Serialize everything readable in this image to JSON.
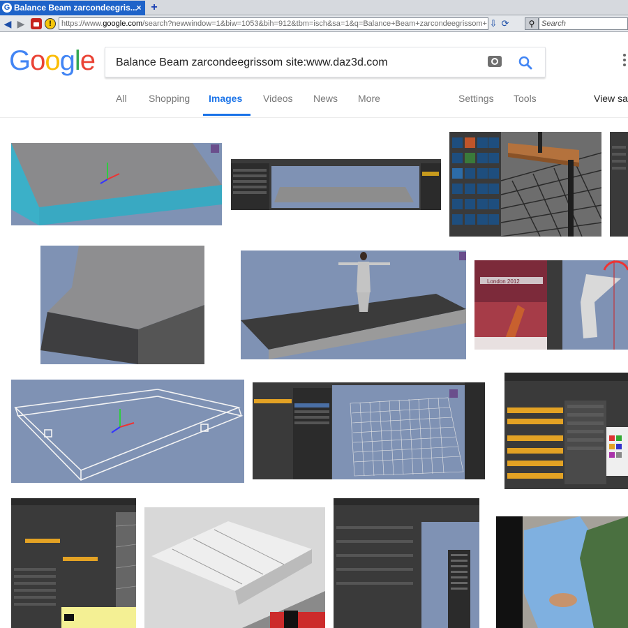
{
  "browser": {
    "tab_title": "Balance Beam zarcondeegris...",
    "tab_close": "×",
    "new_tab": "+",
    "url_prefix": "https://www.",
    "url_domain": "google.com",
    "url_rest": "/search?newwindow=1&biw=1053&bih=912&tbm=isch&sa=1&q=Balance+Beam+zarcondeegrissom+",
    "search_placeholder": "Search"
  },
  "google": {
    "logo_letters": [
      "G",
      "o",
      "o",
      "g",
      "l",
      "e"
    ],
    "logo_colors": [
      "#4285F4",
      "#EA4335",
      "#FBBC05",
      "#4285F4",
      "#34A853",
      "#EA4335"
    ],
    "query": "Balance Beam zarcondeegrissom site:www.daz3d.com",
    "accent": "#1a73e8",
    "tabs": [
      {
        "label": "All",
        "active": false
      },
      {
        "label": "Shopping",
        "active": false
      },
      {
        "label": "Images",
        "active": true
      },
      {
        "label": "Videos",
        "active": false
      },
      {
        "label": "News",
        "active": false
      },
      {
        "label": "More",
        "active": false
      }
    ],
    "settings_label": "Settings",
    "tools_label": "Tools",
    "view_saved_label": "View sav"
  },
  "images": {
    "olympic_banner_text": "London 2012",
    "icons": [
      "camera-icon",
      "search-icon",
      "apps-icon"
    ]
  }
}
